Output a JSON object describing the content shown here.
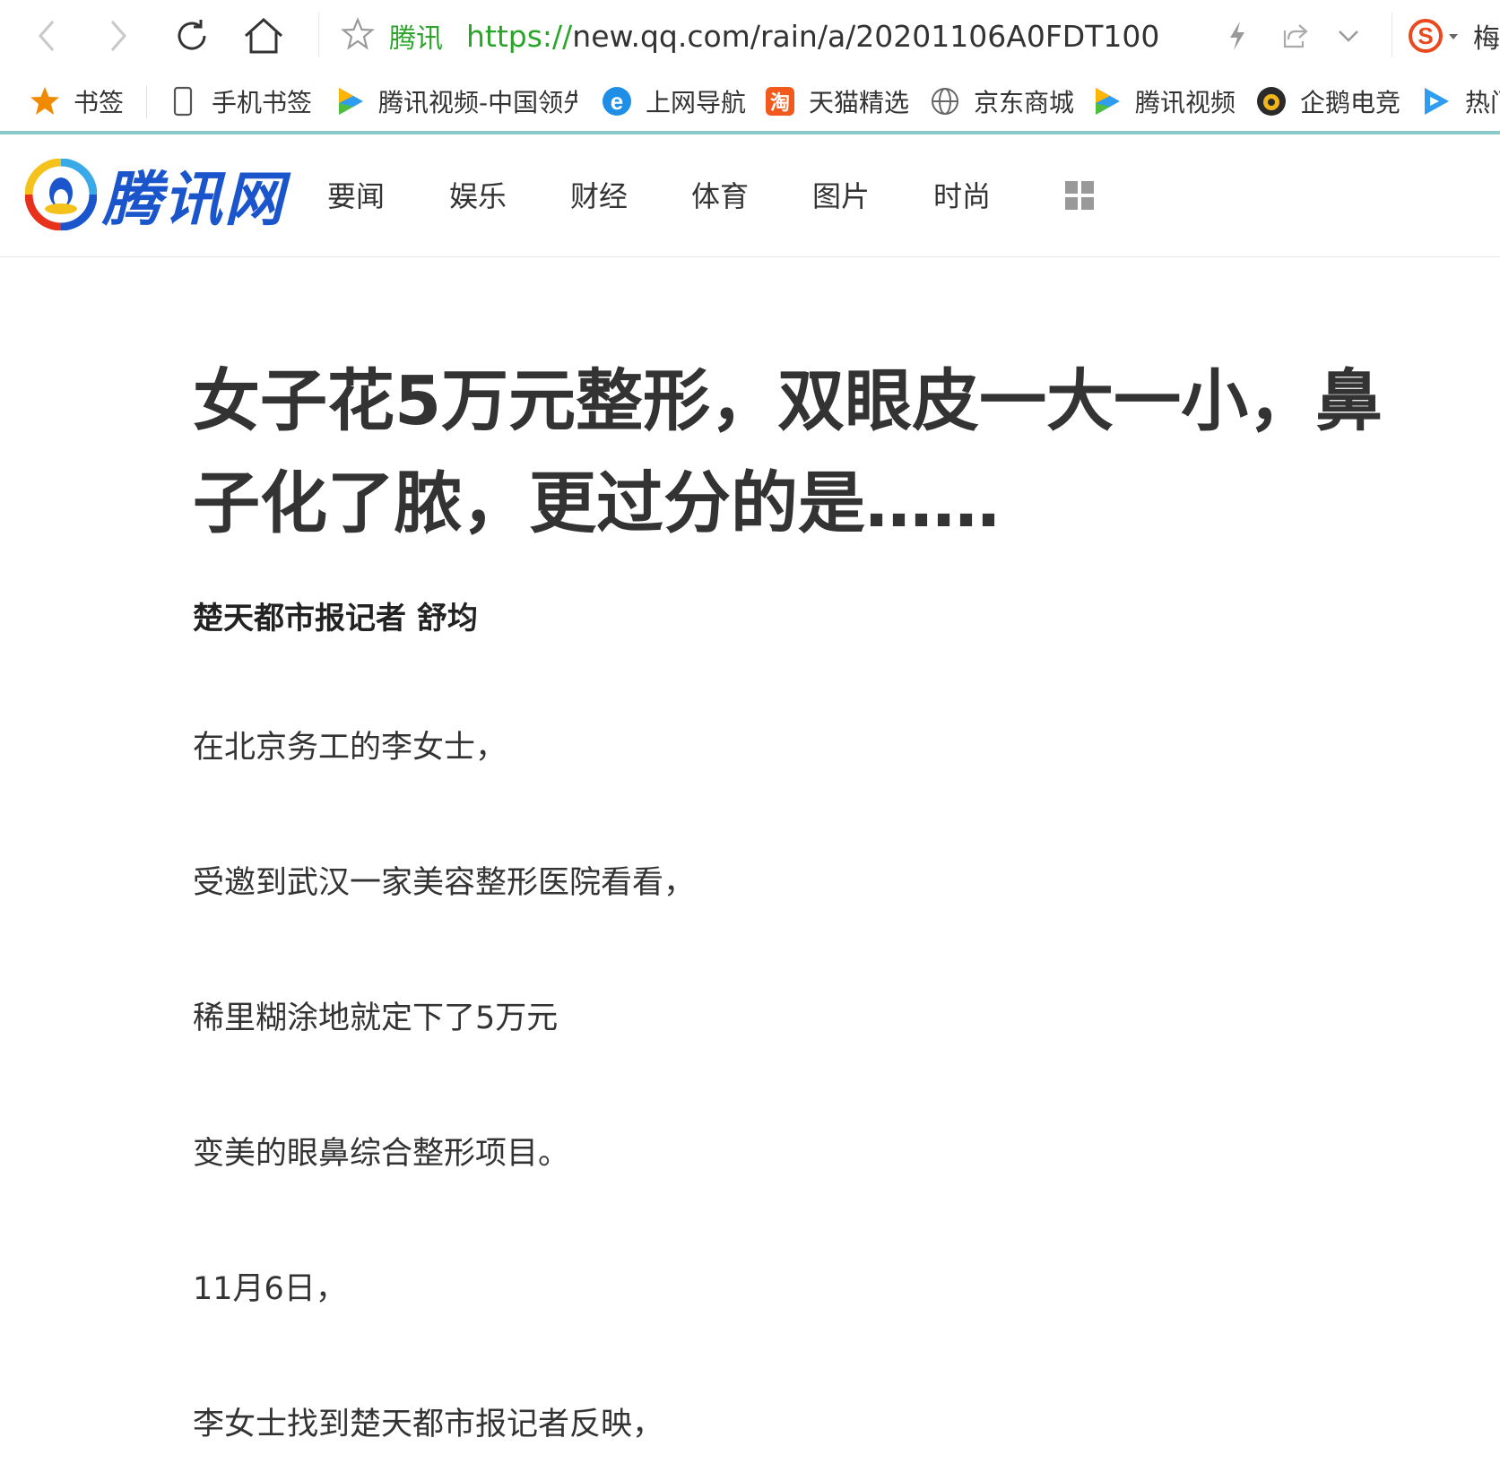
{
  "browser": {
    "url_site": "腾讯",
    "url_scheme": "https://",
    "url_rest": "new.qq.com/rain/a/20201106A0FDT100",
    "profile_label": "梅"
  },
  "bookmarks": [
    {
      "label": "书签",
      "icon": "star-icon"
    },
    {
      "label": "手机书签",
      "icon": "phone-icon"
    },
    {
      "label": "腾讯视频-中国领先",
      "icon": "tencent-video-icon"
    },
    {
      "label": "上网导航",
      "icon": "ie-icon"
    },
    {
      "label": "天猫精选",
      "icon": "taobao-icon"
    },
    {
      "label": "京东商城",
      "icon": "globe-icon"
    },
    {
      "label": "腾讯视频",
      "icon": "tencent-video-icon"
    },
    {
      "label": "企鹅电竞",
      "icon": "penguin-esports-icon"
    },
    {
      "label": "热门",
      "icon": "play-icon"
    }
  ],
  "site": {
    "logo_text": "腾讯网",
    "nav": [
      "要闻",
      "娱乐",
      "财经",
      "体育",
      "图片",
      "时尚"
    ]
  },
  "article": {
    "title": "女子花5万元整形，双眼皮一大一小，鼻子化了脓，更过分的是……",
    "byline": "楚天都市报记者 舒均",
    "paragraphs": [
      "在北京务工的李女士，",
      "受邀到武汉一家美容整形医院看看，",
      "稀里糊涂地就定下了5万元",
      "变美的眼鼻综合整形项目。",
      "11月6日，",
      "李女士找到楚天都市报记者反映，"
    ]
  },
  "colors": {
    "url_green": "#2aa52a",
    "logo_blue": "#1a55cc",
    "bookmark_underline": "#89c9c9"
  }
}
